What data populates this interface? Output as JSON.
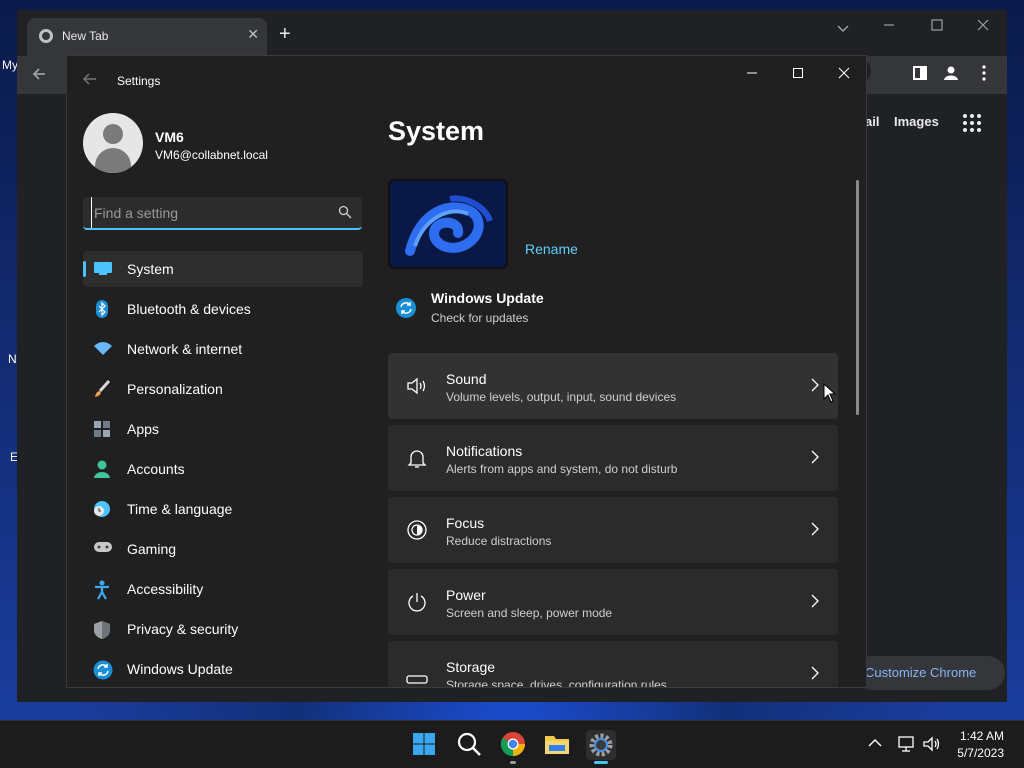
{
  "chrome": {
    "tab_title": "New Tab",
    "tab_close": "✕",
    "new_tab": "+",
    "ntp_links": [
      "ail",
      "Images"
    ],
    "customize_label": "Customize Chrome"
  },
  "desktop": {
    "icon_labels": [
      "My",
      "N",
      "E"
    ]
  },
  "settings": {
    "window_title": "Settings",
    "user": {
      "name": "VM6",
      "email": "VM6@collabnet.local"
    },
    "search_placeholder": "Find a setting",
    "nav": [
      {
        "label": "System",
        "icon": "system-icon",
        "color": "#4cc2ff"
      },
      {
        "label": "Bluetooth & devices",
        "icon": "bluetooth-icon",
        "color": "#1a8fd6"
      },
      {
        "label": "Network & internet",
        "icon": "wifi-icon",
        "color": "#6ab7ff"
      },
      {
        "label": "Personalization",
        "icon": "paintbrush-icon",
        "color": "#f0a04a"
      },
      {
        "label": "Apps",
        "icon": "apps-icon",
        "color": "#9aa5b5"
      },
      {
        "label": "Accounts",
        "icon": "accounts-icon",
        "color": "#3fc59b"
      },
      {
        "label": "Time & language",
        "icon": "clock-globe-icon",
        "color": "#4cc2ff"
      },
      {
        "label": "Gaming",
        "icon": "controller-icon",
        "color": "#c8c8c8"
      },
      {
        "label": "Accessibility",
        "icon": "accessibility-icon",
        "color": "#3ba9f5"
      },
      {
        "label": "Privacy & security",
        "icon": "shield-icon",
        "color": "#9aa0a6"
      },
      {
        "label": "Windows Update",
        "icon": "update-icon",
        "color": "#1a8fd6"
      }
    ],
    "selected_nav": "System",
    "page_title": "System",
    "rename_label": "Rename",
    "windows_update": {
      "title": "Windows Update",
      "subtitle": "Check for updates"
    },
    "cards": [
      {
        "title": "Sound",
        "subtitle": "Volume levels, output, input, sound devices",
        "icon": "speaker-icon"
      },
      {
        "title": "Notifications",
        "subtitle": "Alerts from apps and system, do not disturb",
        "icon": "bell-icon"
      },
      {
        "title": "Focus",
        "subtitle": "Reduce distractions",
        "icon": "focus-icon"
      },
      {
        "title": "Power",
        "subtitle": "Screen and sleep, power mode",
        "icon": "power-icon"
      },
      {
        "title": "Storage",
        "subtitle": "Storage space, drives, configuration rules",
        "icon": "storage-icon"
      }
    ]
  },
  "taskbar": {
    "apps": [
      "start-icon",
      "search-icon",
      "chrome-icon",
      "file-explorer-icon",
      "settings-icon"
    ],
    "clock": {
      "time": "1:42 AM",
      "date": "5/7/2023"
    }
  }
}
